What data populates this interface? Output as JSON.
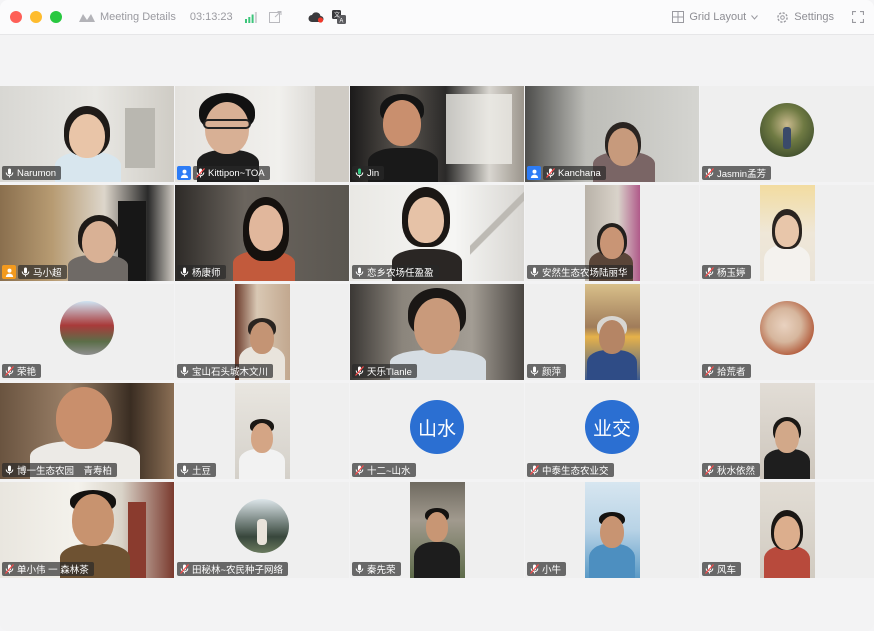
{
  "window": {
    "title": "Meeting Details",
    "timer": "03:13:23",
    "layout_label": "Grid Layout",
    "settings_label": "Settings"
  },
  "colors": {
    "active_speaker_border": "#35c985",
    "initials_avatar": "#2b6fd2",
    "host_badge": "#2d7cf6",
    "cohost_badge": "#f39a1e"
  },
  "participants": [
    {
      "name": "Narumon"
    },
    {
      "name": "Kittipon~TOA",
      "badge": "host"
    },
    {
      "name": "Jin",
      "active": true
    },
    {
      "name": "Kanchana",
      "badge": "host"
    },
    {
      "name": "Jasmin孟芳"
    },
    {
      "name": "马小超",
      "badge": "cohost"
    },
    {
      "name": "杨康师"
    },
    {
      "name": "恋乡农场任盈盈"
    },
    {
      "name": "安然生态农场陆丽华"
    },
    {
      "name": "杨玉婷"
    },
    {
      "name": "荣艳"
    },
    {
      "name": "宝山石头城木文川"
    },
    {
      "name": "天乐Tlanle"
    },
    {
      "name": "颜萍"
    },
    {
      "name": "拾荒者"
    },
    {
      "name": "博一生态农园　青寿柏"
    },
    {
      "name": "土豆"
    },
    {
      "name": "十二~山水",
      "initials": "山水"
    },
    {
      "name": "中泰生态农业交",
      "initials": "业交"
    },
    {
      "name": "秋水依然"
    },
    {
      "name": "单小伟 一 森林茶"
    },
    {
      "name": "田秘林~农民种子网络"
    },
    {
      "name": "秦先荣"
    },
    {
      "name": "小牛"
    },
    {
      "name": "风车"
    }
  ]
}
